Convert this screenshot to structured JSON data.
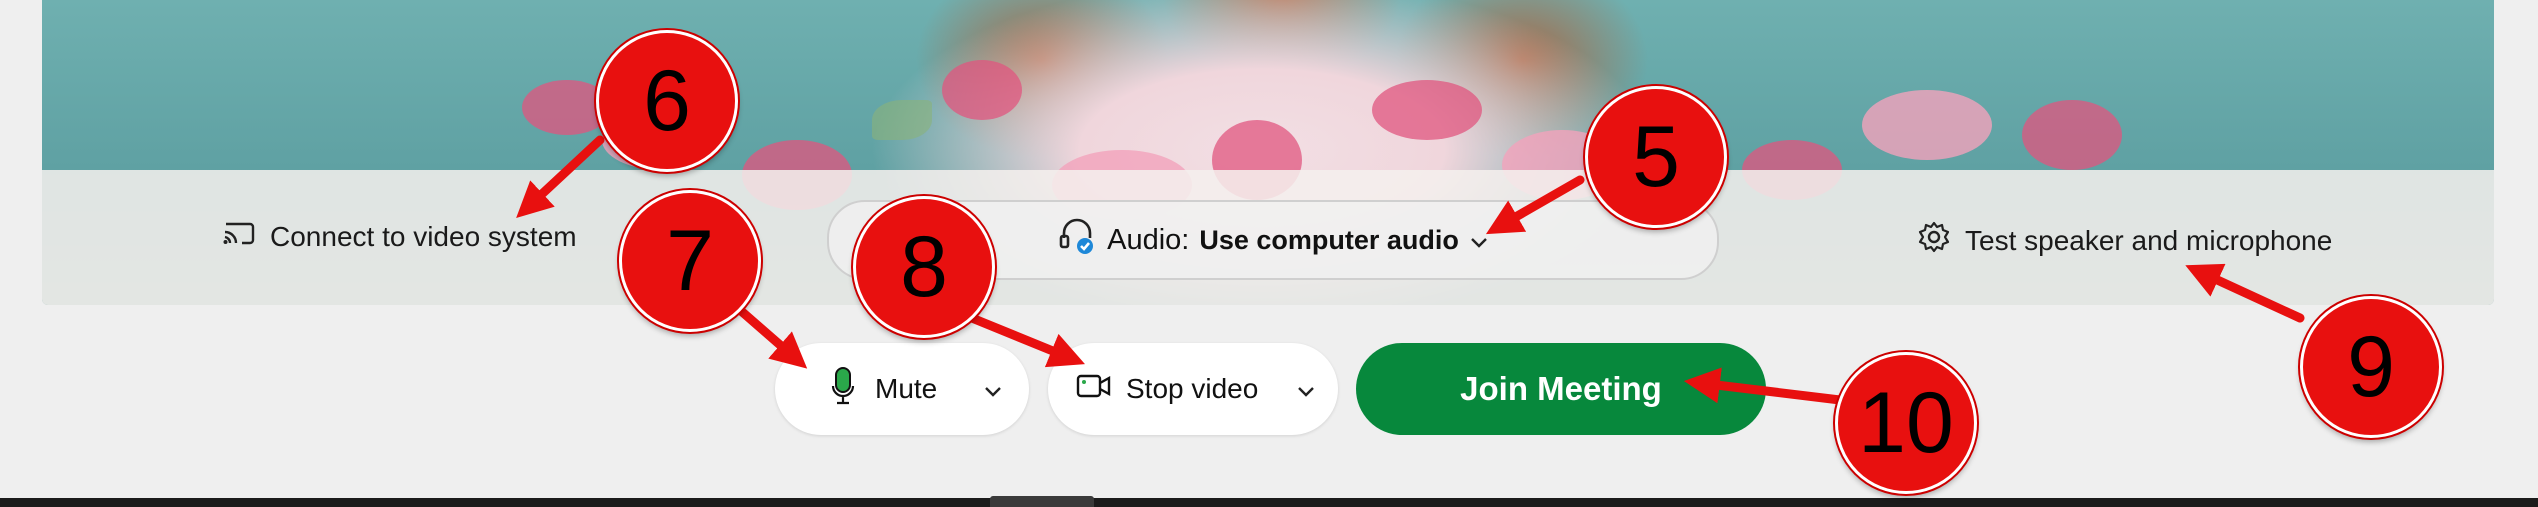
{
  "settings_bar": {
    "connect_label": "Connect to video system",
    "audio_prefix": "Audio:",
    "audio_value": "Use computer audio",
    "test_label": "Test speaker and microphone"
  },
  "controls": {
    "mute_label": "Mute",
    "video_label": "Stop video",
    "join_label": "Join Meeting"
  },
  "annotations": {
    "badge_5": "5",
    "badge_6": "6",
    "badge_7": "7",
    "badge_8": "8",
    "badge_9": "9",
    "badge_10": "10"
  },
  "colors": {
    "join_green": "#07883c",
    "badge_red": "#e8100f",
    "mic_green": "#2aa84a"
  },
  "icons": [
    "cast-icon",
    "headset-icon",
    "chevron-down-icon",
    "gear-icon",
    "microphone-icon",
    "camera-icon"
  ]
}
